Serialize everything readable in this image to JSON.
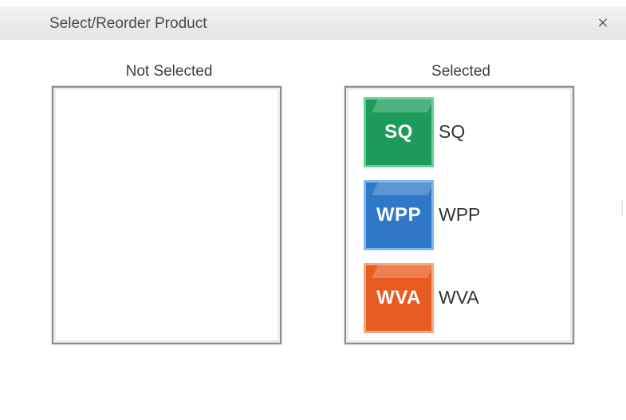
{
  "dialog": {
    "title": "Select/Reorder Product",
    "close_glyph": "×"
  },
  "not_selected": {
    "label": "Not Selected",
    "items": []
  },
  "selected": {
    "label": "Selected",
    "items": [
      {
        "tile_text": "SQ",
        "label": "SQ",
        "color": "#1e9b5a",
        "border": "#5fd293"
      },
      {
        "tile_text": "WPP",
        "label": "WPP",
        "color": "#2f78c9",
        "border": "#7fb6ee"
      },
      {
        "tile_text": "WVA",
        "label": "WVA",
        "color": "#e85b21",
        "border": "#f8a47c"
      }
    ]
  }
}
